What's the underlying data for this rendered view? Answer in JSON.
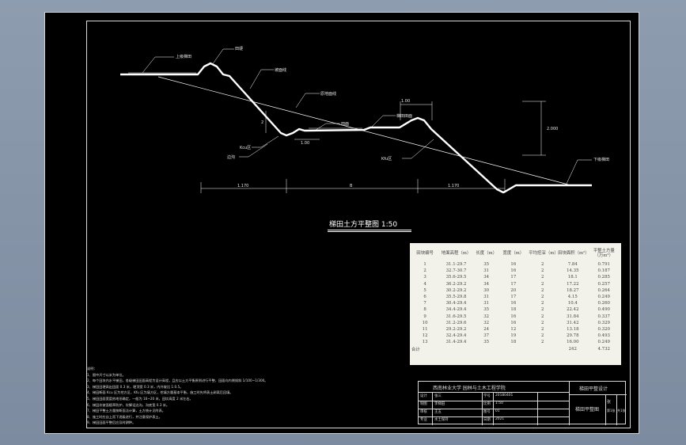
{
  "drawing": {
    "title": "梯田土方平整图   1:50",
    "labels": {
      "upper_field": "上级梯田",
      "ridge": "田埂",
      "slope_top_line": "坡面线",
      "original_slope": "原地面线",
      "terrace_surface": "梯田田面",
      "ditch_side": "边沟",
      "cut_a": "Kcu区",
      "fill_b": "Kfu区",
      "lower_field": "下级梯田",
      "mid_label": "田面",
      "dim_left": "1.170",
      "dim_mid": "B",
      "dim_right": "1.170",
      "dim_ridge_w": "1.00",
      "dim_h": "2.000",
      "dim_small": "1.00",
      "dim_s": "2"
    }
  },
  "table": {
    "headers": [
      "田块编号",
      "地面高程（m）",
      "长度（m）",
      "宽度（m）",
      "平均挖深（m）",
      "田块面积（m²）",
      "平整土方量（万m³）"
    ],
    "rows": [
      [
        "1",
        "31.1-29.7",
        "35",
        "16",
        "2",
        "7.84",
        "0.791"
      ],
      [
        "2",
        "32.7-30.7",
        "31",
        "16",
        "2",
        "14.35",
        "0.187"
      ],
      [
        "3",
        "35.6-29.5",
        "34",
        "17",
        "2",
        "18.1",
        "0.285"
      ],
      [
        "4",
        "36.2-29.2",
        "34",
        "17",
        "2",
        "17.22",
        "0.257"
      ],
      [
        "5",
        "30.2-29.2",
        "30",
        "20",
        "2",
        "18.27",
        "0.264"
      ],
      [
        "6",
        "35.5-29.8",
        "31",
        "17",
        "2",
        "4.15",
        "0.249"
      ],
      [
        "7",
        "30.4-29.4",
        "31",
        "16",
        "2",
        "10.4",
        "0.260"
      ],
      [
        "8",
        "34.4-29.4",
        "35",
        "18",
        "2",
        "22.42",
        "0.490"
      ],
      [
        "9",
        "31.6-29.5",
        "32",
        "16",
        "2",
        "31.84",
        "0.337"
      ],
      [
        "10",
        "31.2-29.6",
        "32",
        "16",
        "2",
        "31.42",
        "0.329"
      ],
      [
        "11",
        "29.2-29.2",
        "24",
        "12",
        "2",
        "13.18",
        "0.320"
      ],
      [
        "12",
        "32.4-29.4",
        "37",
        "19",
        "2",
        "29.78",
        "0.493"
      ],
      [
        "13",
        "31.4-29.4",
        "35",
        "18",
        "2",
        "16.00",
        "0.249"
      ],
      [
        "合计",
        "",
        "",
        "",
        "",
        "242",
        "4.732"
      ]
    ]
  },
  "notes": {
    "heading": "说明：",
    "lines": [
      "1、图中尺寸以米为单位。",
      "2、每个田块内水平梯田，各级梯田田面高程为设计高程，且应以土方平衡原则进行平整，田面向内侧倾斜 1/100~1/300。",
      "3、梯田田埂高出田面 0.3 米，埂顶宽 0.3 米，内外坡比 1:0.5。",
      "4、梯田断面 Kcu 区为挖方区，Kfu 区为填方区，挖填方量基本平衡，施工时先将表土剥离后回填。",
      "5、梯田田面宽度依地形确定，一般为 16~20 米，田坎高度 2 米左右。",
      "6、梯田坎坡面植草防护，坎脚设边沟，沟底宽 0.3 米。",
      "7、梯田平整土方量按断面法计算，土方统计见附表。",
      "8、施工时应自上而下逐级进行，并注意保护表土。",
      "9、梯田田面平整后应及时耕种。"
    ]
  },
  "title_block": {
    "school": "西南林业大学  园林与土木工程学院",
    "project": "梯田平整设计",
    "drawing_name": "梯田平整图",
    "rows": [
      [
        "设计",
        "张三",
        "学号",
        "20180401"
      ],
      [
        "制图",
        "李梯田",
        "比例",
        "1:50"
      ],
      [
        "审核",
        "王五",
        "图号",
        "01"
      ],
      [
        "专业",
        "水土保持",
        "日期",
        "2021"
      ]
    ],
    "sheet_label": "张",
    "sheet_no": "第1张",
    "sheet_total": "共1张"
  }
}
